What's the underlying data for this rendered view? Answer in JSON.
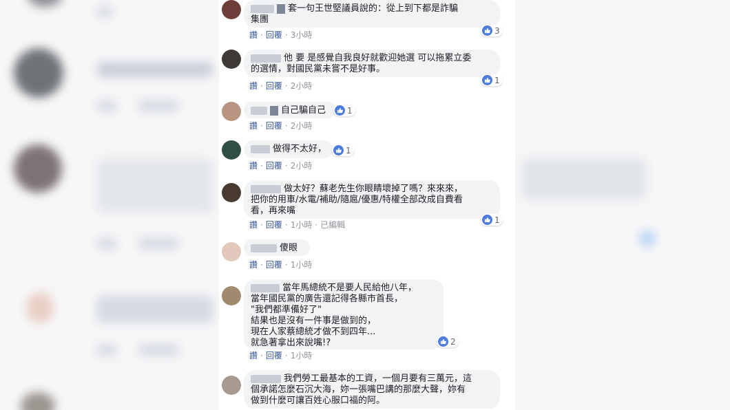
{
  "actions": {
    "like": "讚",
    "reply": "回覆",
    "edited": "已編輯",
    "dot": "·"
  },
  "comments": [
    {
      "text": "套一句王世堅議員說的：從上到下都是詐騙\n集團",
      "time": "3小時",
      "likes": "3"
    },
    {
      "text": "他 要 是感覺自我良好就歡迎她選 可以拖累立委\n的選情，對國民黨未嘗不是好事。",
      "time": "2小時",
      "likes": "1"
    },
    {
      "text": "自己騙自己",
      "time": "2小時",
      "likes": "1"
    },
    {
      "text": "做得不太好，",
      "time": "2小時",
      "likes": "1"
    },
    {
      "text": "做太好？蘇老先生你眼睛壞掉了嗎？來來來，\n把你的用車/水電/補助/隨扈/優惠/特權全部改成自費看\n看，再來嘴",
      "time": "1小時",
      "likes": "1"
    },
    {
      "text": "傻眼",
      "time": "1小時",
      "likes": ""
    },
    {
      "text": "當年馬總統不是要人民給他八年，\n當年國民黨的廣告還記得各縣市首長，\n\"我們都準備好了\"\n結果也是沒有一件事是做到的，\n現在人家蔡總統才做不到四年...\n就急著拿出來說嘴!?",
      "time": "1小時",
      "likes": "2"
    },
    {
      "text": "我們勞工最基本的工資，一個月要有三萬元，這\n個承諾怎麼石沉大海，妳一張嘴巴講的那麼大聲，妳有\n做到什麼可讓百姓心服口福的阿。",
      "time": "",
      "likes": ""
    }
  ],
  "colors": {
    "link": "#385898",
    "bubble": "#f2f3f5",
    "like": "#4b7bdc"
  }
}
